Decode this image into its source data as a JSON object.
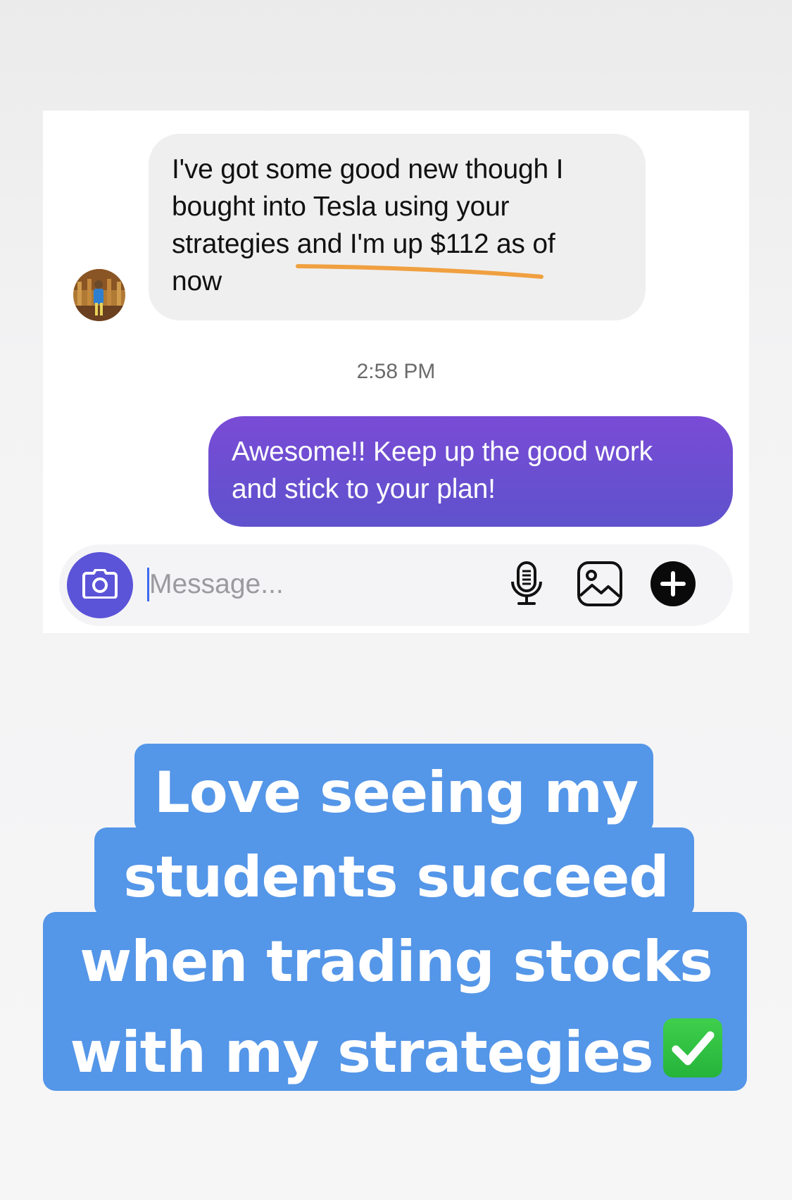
{
  "conversation": {
    "incoming": {
      "text": "I've got some good new though I\nbought into Tesla using your\nstrategies and I'm up $112 as of\nnow",
      "highlight_color": "#f0a040"
    },
    "timestamp": "2:58 PM",
    "outgoing": {
      "text": "Awesome!! Keep up the good work\nand stick to your plan!"
    }
  },
  "composer": {
    "placeholder": "Message...",
    "icons": {
      "camera": "camera-icon",
      "mic": "microphone-icon",
      "gallery": "gallery-icon",
      "add": "plus-circle-icon"
    }
  },
  "caption": {
    "lines": [
      "Love seeing my",
      "students succeed",
      "when trading stocks",
      "with my strategies"
    ],
    "emoji": "check-mark-button-icon",
    "background_color": "#5496e8"
  },
  "colors": {
    "outgoing_bubble": "#6a4fd0",
    "incoming_bubble": "#efefef",
    "camera_button": "#5b53d8"
  }
}
